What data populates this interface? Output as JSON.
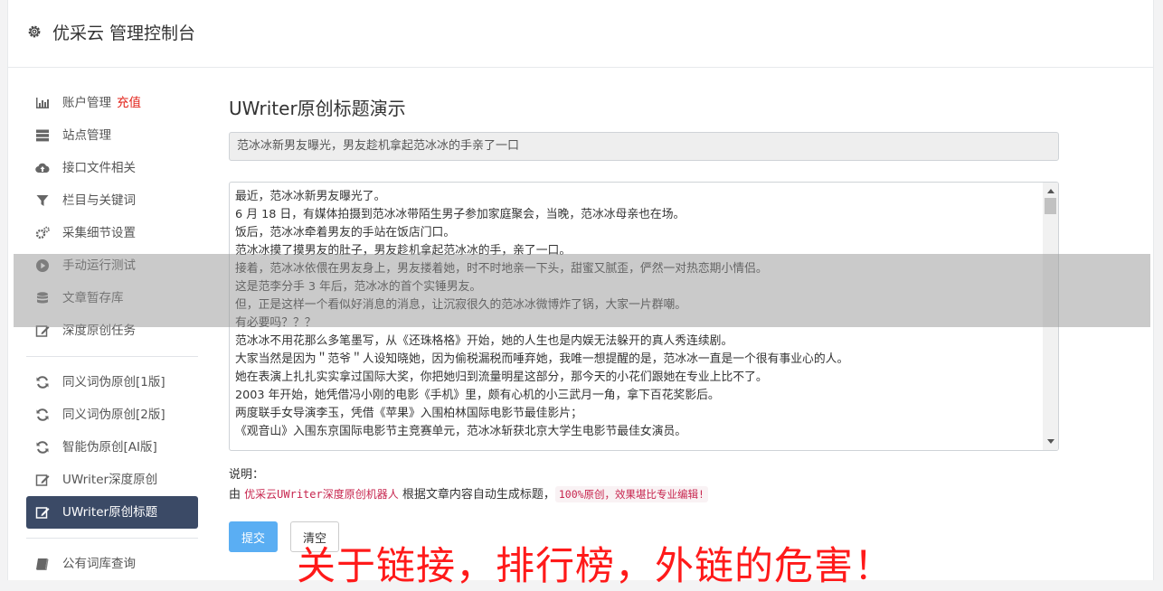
{
  "app": {
    "title": "优采云 管理控制台"
  },
  "sidebar": {
    "group1": [
      {
        "label": "账户管理",
        "badge": "充值",
        "icon": "bar-chart-icon"
      },
      {
        "label": "站点管理",
        "icon": "server-icon"
      },
      {
        "label": "接口文件相关",
        "icon": "cloud-upload-icon"
      },
      {
        "label": "栏目与关键词",
        "icon": "filter-icon"
      },
      {
        "label": "采集细节设置",
        "icon": "gears-icon"
      },
      {
        "label": "手动运行测试",
        "icon": "play-circle-icon"
      },
      {
        "label": "文章暂存库",
        "icon": "database-icon"
      },
      {
        "label": "深度原创任务",
        "icon": "edit-icon"
      }
    ],
    "group2": [
      {
        "label": "同义词伪原创[1版]",
        "icon": "refresh-icon"
      },
      {
        "label": "同义词伪原创[2版]",
        "icon": "refresh-icon"
      },
      {
        "label": "智能伪原创[AI版]",
        "icon": "refresh-icon"
      },
      {
        "label": "UWriter深度原创",
        "icon": "edit-icon"
      },
      {
        "label": "UWriter原创标题",
        "icon": "edit-icon",
        "active": true
      }
    ],
    "group3": [
      {
        "label": "公有词库查询",
        "icon": "book-icon"
      }
    ]
  },
  "main": {
    "heading": "UWriter原创标题演示",
    "title_value": "范冰冰新男友曝光，男友趁机拿起范冰冰的手亲了一口",
    "content_lines": [
      "最近，范冰冰新男友曝光了。",
      "6 月 18 日，有媒体拍摄到范冰冰带陌生男子参加家庭聚会，当晚，范冰冰母亲也在场。",
      "饭后，范冰冰牵着男友的手站在饭店门口。",
      "范冰冰摸了摸男友的肚子，男友趁机拿起范冰冰的手，亲了一口。",
      "接着，范冰冰依偎在男友身上，男友搂着她，时不时地亲一下头，甜蜜又腻歪，俨然一对热恋期小情侣。",
      "这是范李分手 3 年后，范冰冰的首个实锤男友。",
      "但，正是这样一个看似好消息的消息，让沉寂很久的范冰冰微博炸了锅，大家一片群嘲。",
      "有必要吗？？？",
      "范冰冰不用花那么多笔墨写，从《还珠格格》开始，她的人生也是内娱无法躲开的真人秀连续剧。",
      "大家当然是因为＂范爷＂人设知晓她，因为偷税漏税而唾弃她，我唯一想提醒的是，范冰冰一直是一个很有事业心的人。",
      "她在表演上扎扎实实拿过国际大奖，你把她归到流量明星这部分，那今天的小花们跟她在专业上比不了。",
      "2003 年开始，她凭借冯小刚的电影《手机》里，颇有心机的小三武月一角，拿下百花奖影后。",
      "两度联手女导演李玉，凭借《苹果》入围柏林国际电影节最佳影片；",
      "《观音山》入围东京国际电影节主竞赛单元，范冰冰斩获北京大学生电影节最佳女演员。"
    ],
    "note_label": "说明：",
    "note_prefix": "由 ",
    "note_highlight": "优采云UWriter深度原创机器人",
    "note_middle": " 根据文章内容自动生成标题，",
    "note_code": "100%原创，效果堪比专业编辑!",
    "submit_label": "提交",
    "clear_label": "清空"
  },
  "watermark": "关于链接，排行榜，外链的危害！",
  "colors": {
    "active_bg": "#3b4a66",
    "submit": "#5aaef3",
    "badge": "#e2231a",
    "watermark": "#ff1a1a"
  }
}
